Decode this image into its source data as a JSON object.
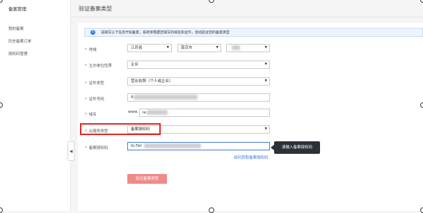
{
  "sidebar": {
    "title": "备案管理",
    "items": [
      {
        "label": "我的备案"
      },
      {
        "label": "历史备案订单"
      },
      {
        "label": "授权码管理"
      }
    ]
  },
  "page": {
    "title": "验证备案类型"
  },
  "info": {
    "text": "请填写以下信息开始备案，系统将根据您填写的域名和证件，自动验证您的备案类型"
  },
  "form": {
    "region": {
      "label": "地域",
      "province": "江苏省",
      "city": "南京市",
      "district": ""
    },
    "organizer_nature": {
      "label": "主办单位性质",
      "value": "企业"
    },
    "id_type": {
      "label": "证件类型",
      "value": "营业执照（个人或企业）"
    },
    "id_number": {
      "label": "证件号码",
      "value": "9"
    },
    "domain": {
      "label": "域名",
      "prefix": "www.",
      "value": "le"
    },
    "service_type": {
      "label": "云服务类型",
      "value": "备案授权码"
    },
    "auth_code": {
      "label": "备案授权码",
      "value": "0c7bf"
    },
    "tooltip": "请输入备案授权码",
    "help_link": "如何获取备案授权码",
    "submit_label": "验证备案类型"
  },
  "colors": {
    "accent": "#3a7bd5",
    "required": "#e04040",
    "highlight": "#e02424",
    "submit": "#ef8a8a"
  },
  "icons": {
    "info": "info-icon",
    "caret": "caret-down-icon",
    "collapse": "chevron-left-icon"
  }
}
